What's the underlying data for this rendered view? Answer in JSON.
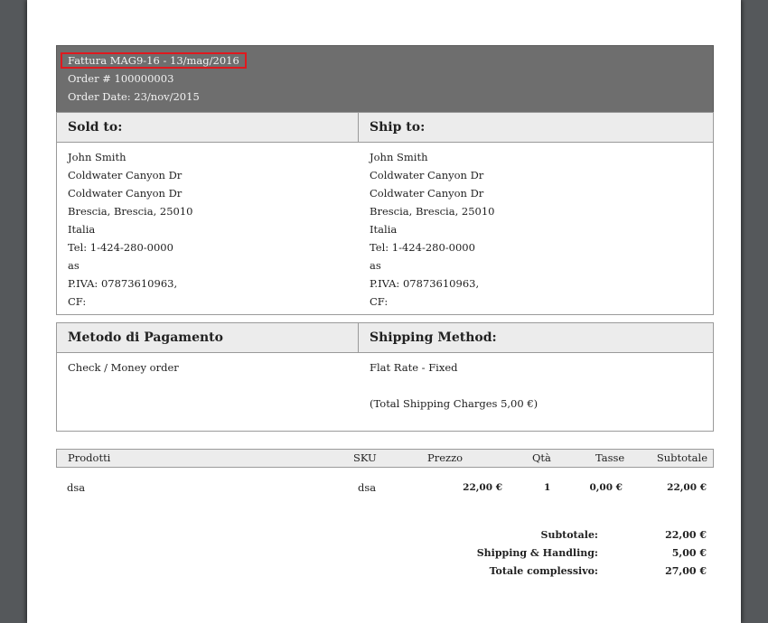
{
  "header": {
    "invoice_title": "Fattura MAG9-16 - 13/mag/2016",
    "order_number": "Order # 100000003",
    "order_date": "Order Date: 23/nov/2015"
  },
  "address_box": {
    "sold_to_label": "Sold to:",
    "ship_to_label": "Ship to:",
    "sold_to": [
      "John Smith",
      "Coldwater Canyon Dr",
      "Coldwater Canyon Dr",
      "Brescia, Brescia, 25010",
      "Italia",
      "Tel: 1-424-280-0000",
      "as",
      "P.IVA: 07873610963,",
      "CF:"
    ],
    "ship_to": [
      "John Smith",
      "Coldwater Canyon Dr",
      "Coldwater Canyon Dr",
      "Brescia, Brescia, 25010",
      "Italia",
      "Tel: 1-424-280-0000",
      "as",
      "P.IVA: 07873610963,",
      "CF:"
    ]
  },
  "method_box": {
    "payment_label": "Metodo di Pagamento",
    "shipping_label": "Shipping Method:",
    "payment_value": "Check / Money order",
    "shipping_value": "Flat Rate - Fixed",
    "shipping_charges": "(Total Shipping Charges 5,00 €)"
  },
  "items": {
    "columns": {
      "product": "Prodotti",
      "sku": "SKU",
      "price": "Prezzo",
      "qty": "Qtà",
      "tax": "Tasse",
      "subtotal": "Subtotale"
    },
    "rows": [
      {
        "product": "dsa",
        "sku": "dsa",
        "price": "22,00 €",
        "qty": "1",
        "tax": "0,00 €",
        "subtotal": "22,00 €"
      }
    ]
  },
  "totals": [
    {
      "label": "Subtotale:",
      "value": "22,00 €"
    },
    {
      "label": "Shipping & Handling:",
      "value": "5,00 €"
    },
    {
      "label": "Totale complessivo:",
      "value": "27,00 €"
    }
  ]
}
